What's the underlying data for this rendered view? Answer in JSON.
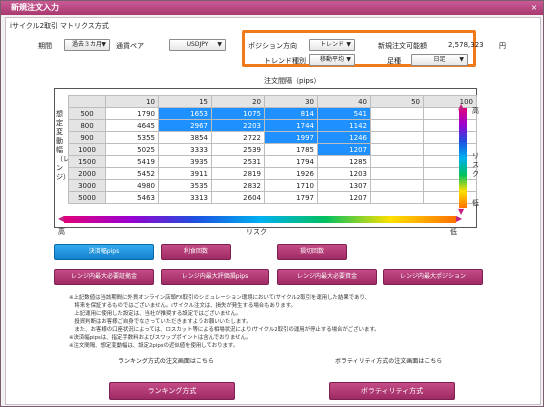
{
  "window": {
    "title": "新規注文入力",
    "close": "×"
  },
  "mode": {
    "title": "iサイクル2取引",
    "sub": "マトリクス方式"
  },
  "row1": {
    "period_label": "期間",
    "period_value": "過去３カ月",
    "pair_label": "通貨ペア",
    "pair_value": "USDJPY",
    "dir_label": "ポジション方向",
    "dir_value": "トレンド",
    "avail_label": "新規注文可能額",
    "avail_value": "2,578,323",
    "avail_unit": "円"
  },
  "row2": {
    "trend_label": "トレンド種別",
    "trend_value": "移動平均",
    "bar_label": "足種",
    "bar_value": "日足"
  },
  "matrix": {
    "col_header": "注文間隔（pips）",
    "row_header": "想定変動幅（レンジ）",
    "cols": [
      "10",
      "15",
      "20",
      "30",
      "40",
      "50",
      "100"
    ],
    "rows": [
      {
        "range": "500",
        "vals": [
          "1790",
          "1653",
          "1075",
          "814",
          "541",
          "",
          ""
        ]
      },
      {
        "range": "800",
        "vals": [
          "4645",
          "2967",
          "2203",
          "1744",
          "1142",
          "",
          ""
        ]
      },
      {
        "range": "900",
        "vals": [
          "5355",
          "3854",
          "2722",
          "1997",
          "1246",
          "",
          ""
        ]
      },
      {
        "range": "1000",
        "vals": [
          "5025",
          "3333",
          "2539",
          "1785",
          "1207",
          "",
          ""
        ]
      },
      {
        "range": "1500",
        "vals": [
          "5419",
          "3935",
          "2531",
          "1794",
          "1285",
          "",
          ""
        ]
      },
      {
        "range": "2000",
        "vals": [
          "5452",
          "3911",
          "2819",
          "1926",
          "1203",
          "",
          ""
        ]
      },
      {
        "range": "3000",
        "vals": [
          "4980",
          "3535",
          "2832",
          "1710",
          "1307",
          "",
          ""
        ]
      },
      {
        "range": "5000",
        "vals": [
          "5463",
          "3313",
          "2604",
          "1797",
          "1207",
          "",
          ""
        ]
      }
    ],
    "highlight": [
      [
        0,
        1
      ],
      [
        0,
        2
      ],
      [
        0,
        3
      ],
      [
        0,
        4
      ],
      [
        1,
        1
      ],
      [
        1,
        2
      ],
      [
        1,
        3
      ],
      [
        1,
        4
      ],
      [
        2,
        3
      ],
      [
        2,
        4
      ],
      [
        3,
        4
      ]
    ]
  },
  "risk": {
    "high": "高",
    "low": "低",
    "label": "リスク"
  },
  "buttons": {
    "row1": [
      "決済幅pips",
      "利食回数",
      "損切回数"
    ],
    "row2": [
      "レンジ内最大必要証拠金",
      "レンジ内最大評価損pips",
      "レンジ内最大必要資金",
      "レンジ内最大ポジション"
    ],
    "ranking": "ランキング方式",
    "volatility": "ボラティリティ方式"
  },
  "notes": [
    "※上記数値は当該期間に外貨オンライン店頭FX取引のシミュレーション環境においてiサイクル2取引を運用した結果であり、",
    "　将来を保証するものではございません。iサイクル注文は、損失が発生する場合もあります。",
    "　上記運用に使用した設定は、当社が推奨する設定ではございません。",
    "　投資判断はお客様ご自身でなさっていただきますようお願いいたします。",
    "　また、お客様の口座状況によっては、ロスカット等による相場状況によりiサイクル2取引の運用が停止する場合がございます。",
    "※決済幅pipsは、指定手数料およびスワップポイントは含んでおりません。",
    "※注文間隔、想定変動幅は、設定2pipsの近似値を使用しております。"
  ],
  "footer": {
    "rank_label": "ランキング方式の注文画面はこちら",
    "vol_label": "ボラティリティ方式の注文画面はこちら"
  },
  "colors": {
    "accent": "#c44b86",
    "highlight": "#1e90ff",
    "orange": "#f07a1a"
  }
}
